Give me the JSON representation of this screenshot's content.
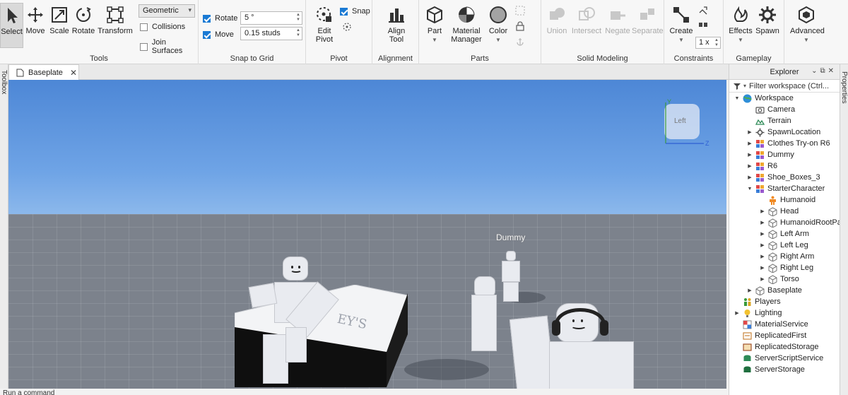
{
  "ribbon": {
    "tools": {
      "group_label": "Tools",
      "buttons": [
        {
          "label": "Select",
          "icon": "cursor-icon"
        },
        {
          "label": "Move",
          "icon": "move-arrows-icon"
        },
        {
          "label": "Scale",
          "icon": "scale-icon"
        },
        {
          "label": "Rotate",
          "icon": "rotate-icon"
        },
        {
          "label": "Transform",
          "icon": "transform-icon"
        }
      ],
      "mode_select": "Geometric",
      "collisions_label": "Collisions",
      "join_surfaces_label": "Join Surfaces"
    },
    "snap_to_grid": {
      "group_label": "Snap to Grid",
      "rotate_label": "Rotate",
      "rotate_value": "5 °",
      "move_label": "Move",
      "move_value": "0.15 studs"
    },
    "pivot": {
      "group_label": "Pivot",
      "edit_pivot_label": "Edit Pivot",
      "snap_label": "Snap"
    },
    "alignment": {
      "group_label": "Alignment",
      "align_tool_label": "Align Tool"
    },
    "parts": {
      "group_label": "Parts",
      "part_label": "Part",
      "material_manager_label": "Material Manager",
      "color_label": "Color"
    },
    "solid_modeling": {
      "group_label": "Solid Modeling",
      "union_label": "Union",
      "intersect_label": "Intersect",
      "negate_label": "Negate",
      "separate_label": "Separate"
    },
    "constraints": {
      "group_label": "Constraints",
      "create_label": "Create",
      "scale_value": "1 x"
    },
    "gameplay": {
      "group_label": "Gameplay",
      "effects_label": "Effects",
      "spawn_label": "Spawn"
    },
    "advanced": {
      "label": "Advanced"
    }
  },
  "tabs": {
    "toolbox_label": "Toolbox",
    "active_tab": "Baseplate",
    "properties_label": "Properties"
  },
  "viewport": {
    "dummy_label": "Dummy",
    "view_cube_label": "Left",
    "axis_y": "Y",
    "axis_z": "Z",
    "sign_text": "EY'S"
  },
  "explorer": {
    "title": "Explorer",
    "filter_placeholder": "Filter workspace (Ctrl...",
    "items": [
      {
        "label": "Workspace",
        "indent": 0,
        "toggle": "expanded",
        "icon": "globe-icon"
      },
      {
        "label": "Camera",
        "indent": 1,
        "toggle": "none",
        "icon": "camera-icon"
      },
      {
        "label": "Terrain",
        "indent": 1,
        "toggle": "none",
        "icon": "terrain-icon"
      },
      {
        "label": "SpawnLocation",
        "indent": 1,
        "toggle": "collapsed",
        "icon": "gear-icon"
      },
      {
        "label": "Clothes Try-on R6",
        "indent": 1,
        "toggle": "collapsed",
        "icon": "model-icon"
      },
      {
        "label": "Dummy",
        "indent": 1,
        "toggle": "collapsed",
        "icon": "model-icon"
      },
      {
        "label": "R6",
        "indent": 1,
        "toggle": "collapsed",
        "icon": "model-icon"
      },
      {
        "label": "Shoe_Boxes_3",
        "indent": 1,
        "toggle": "collapsed",
        "icon": "model-icon"
      },
      {
        "label": "StarterCharacter",
        "indent": 1,
        "toggle": "expanded",
        "icon": "model-icon"
      },
      {
        "label": "Humanoid",
        "indent": 2,
        "toggle": "none",
        "icon": "humanoid-icon"
      },
      {
        "label": "Head",
        "indent": 2,
        "toggle": "collapsed",
        "icon": "part-icon"
      },
      {
        "label": "HumanoidRootPart",
        "indent": 2,
        "toggle": "collapsed",
        "icon": "part-icon"
      },
      {
        "label": "Left Arm",
        "indent": 2,
        "toggle": "collapsed",
        "icon": "part-icon"
      },
      {
        "label": "Left Leg",
        "indent": 2,
        "toggle": "collapsed",
        "icon": "part-icon"
      },
      {
        "label": "Right Arm",
        "indent": 2,
        "toggle": "collapsed",
        "icon": "part-icon"
      },
      {
        "label": "Right Leg",
        "indent": 2,
        "toggle": "collapsed",
        "icon": "part-icon"
      },
      {
        "label": "Torso",
        "indent": 2,
        "toggle": "collapsed",
        "icon": "part-icon"
      },
      {
        "label": "Baseplate",
        "indent": 1,
        "toggle": "collapsed",
        "icon": "part-icon"
      },
      {
        "label": "Players",
        "indent": 0,
        "toggle": "none",
        "icon": "players-icon"
      },
      {
        "label": "Lighting",
        "indent": 0,
        "toggle": "collapsed",
        "icon": "lightbulb-icon"
      },
      {
        "label": "MaterialService",
        "indent": 0,
        "toggle": "none",
        "icon": "material-service-icon"
      },
      {
        "label": "ReplicatedFirst",
        "indent": 0,
        "toggle": "none",
        "icon": "replicated-first-icon"
      },
      {
        "label": "ReplicatedStorage",
        "indent": 0,
        "toggle": "none",
        "icon": "replicated-storage-icon"
      },
      {
        "label": "ServerScriptService",
        "indent": 0,
        "toggle": "none",
        "icon": "server-script-icon"
      },
      {
        "label": "ServerStorage",
        "indent": 0,
        "toggle": "none",
        "icon": "server-storage-icon"
      }
    ]
  },
  "statusbar": {
    "command_placeholder": "Run a command"
  },
  "colors": {
    "accent": "#1a7ad4",
    "sky_top": "#4d87d6",
    "floor": "#7c828c"
  }
}
